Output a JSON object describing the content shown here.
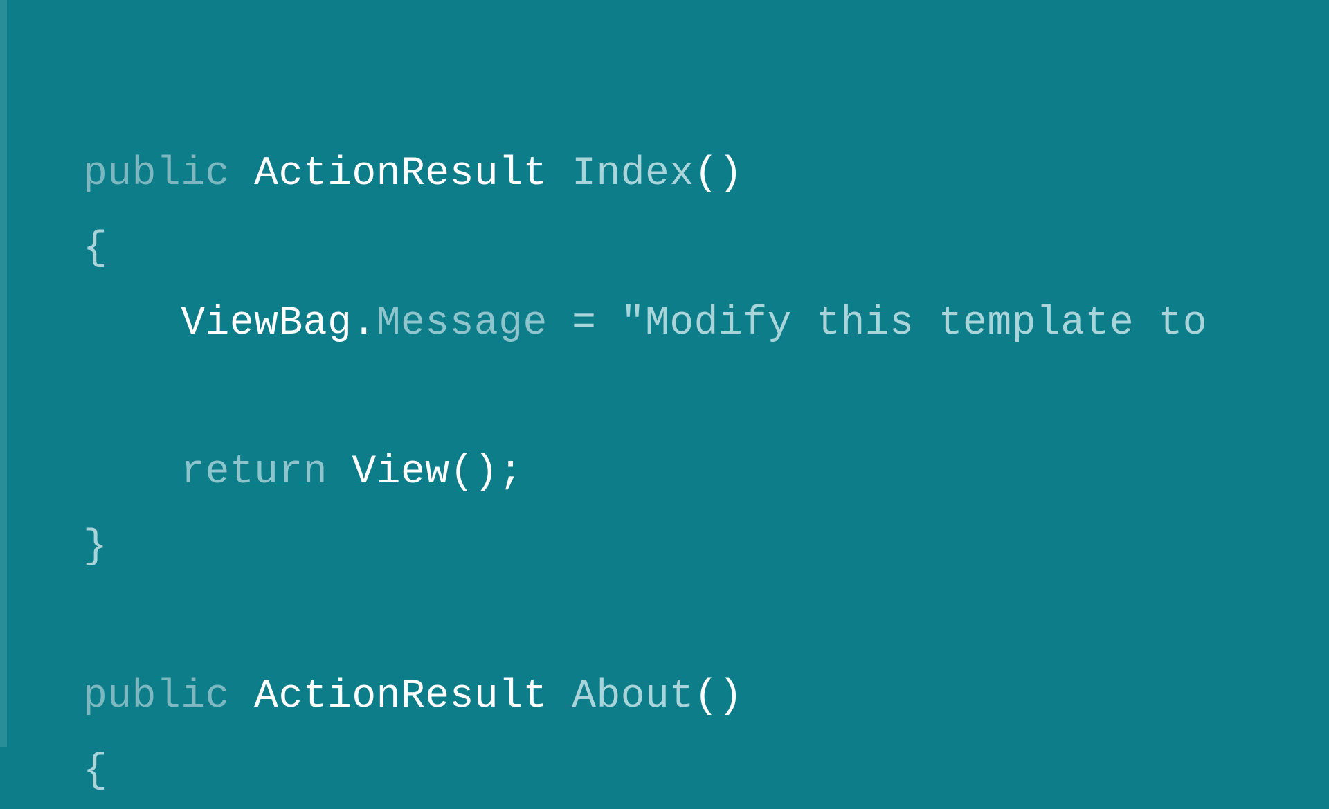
{
  "code": {
    "line1": {
      "kw_public": "public",
      "type": "ActionResult",
      "method": "Index",
      "parens": "()"
    },
    "line2": {
      "brace": "{"
    },
    "line3": {
      "indent": "    ",
      "object": "ViewBag",
      "dot": ".",
      "property": "Message",
      "equals": " = ",
      "string": "\"Modify this template to"
    },
    "line4": {
      "blank": ""
    },
    "line5": {
      "indent": "    ",
      "kw_return": "return",
      "space": " ",
      "call": "View",
      "parens": "();"
    },
    "line6": {
      "brace": "}"
    },
    "line7": {
      "blank": ""
    },
    "line8": {
      "kw_public": "public",
      "type": "ActionResult",
      "method": "About",
      "parens": "()"
    },
    "line9": {
      "brace": "{"
    }
  }
}
